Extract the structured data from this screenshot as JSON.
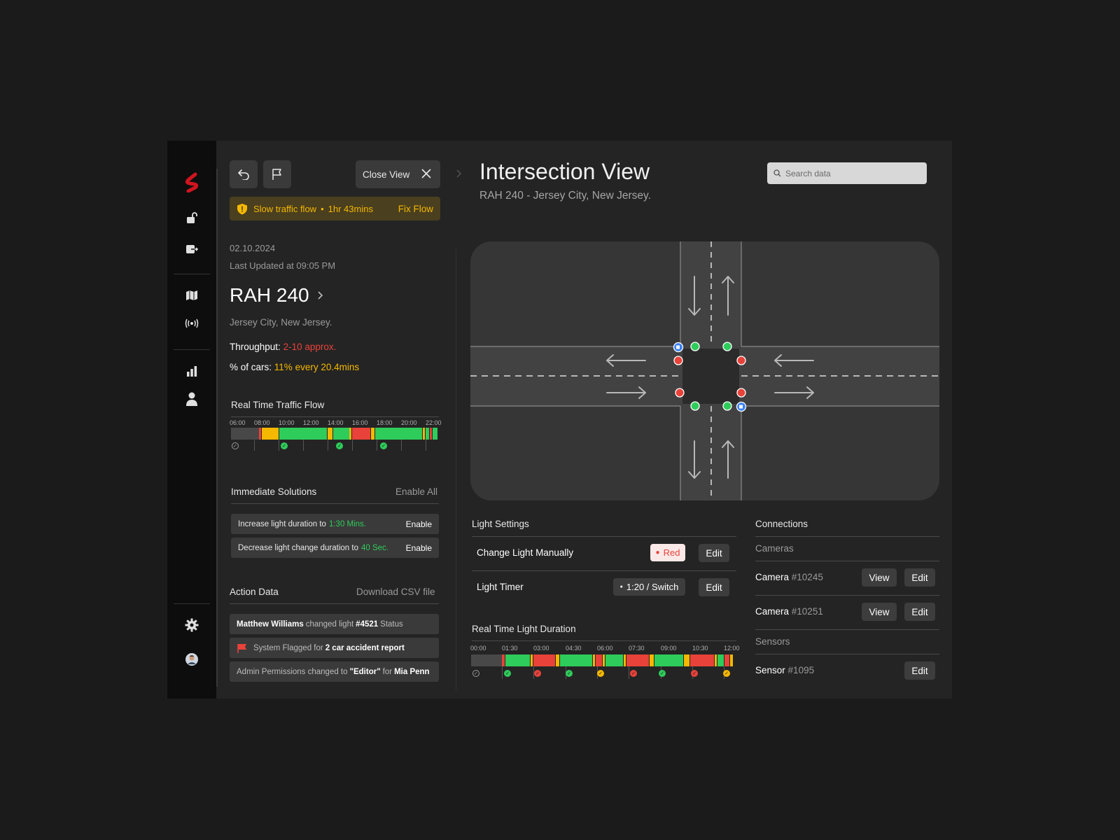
{
  "rail": {
    "icons": [
      "logo-icon",
      "unlock-icon",
      "logout-icon",
      "map-icon",
      "broadcast-icon",
      "bar-chart-icon",
      "user-icon",
      "gear-icon",
      "avatar"
    ]
  },
  "header": {
    "close_view": "Close View",
    "alert_text": "Slow traffic flow",
    "alert_duration": "1hr 43mins",
    "fix_flow": "Fix Flow"
  },
  "info": {
    "date": "02.10.2024",
    "last_updated": "Last Updated at 09:05 PM",
    "title": "RAH 240",
    "location": "Jersey City, New Jersey.",
    "throughput_label": "Throughput:",
    "throughput_value": "2-10 approx.",
    "cars_label": "% of cars:",
    "cars_value": "11% every 20.4mins"
  },
  "traffic_flow": {
    "title": "Real Time Traffic Flow",
    "times": [
      "06:00",
      "08:00",
      "10:00",
      "12:00",
      "14:00",
      "16:00",
      "18:00",
      "20:00",
      "22:00"
    ]
  },
  "solutions": {
    "title": "Immediate Solutions",
    "enable_all": "Enable All",
    "items": [
      {
        "text": "Increase light duration to",
        "value": "1:30 Mins.",
        "action": "Enable"
      },
      {
        "text": "Decrease light change duration to",
        "value": "40 Sec.",
        "action": "Enable"
      }
    ]
  },
  "action_data": {
    "title": "Action Data",
    "download": "Download CSV file",
    "rows": [
      {
        "a": "Matthew Williams",
        "b": "changed light",
        "c": "#4521",
        "d": "Status"
      },
      {
        "a": "System Flagged for",
        "b": "2 car accident report"
      },
      {
        "a": "Admin Permissions changed to",
        "b": "\"Editor\"",
        "c": "for",
        "d": "Mia Penn"
      }
    ]
  },
  "main": {
    "title": "Intersection View",
    "subtitle": "RAH 240 - Jersey City, New Jersey.",
    "search_placeholder": "Search data"
  },
  "light_settings": {
    "title": "Light Settings",
    "manual_label": "Change Light Manually",
    "manual_value": "Red",
    "timer_label": "Light Timer",
    "timer_value": "1:20 / Switch",
    "edit": "Edit"
  },
  "light_duration": {
    "title": "Real Time Light Duration",
    "times": [
      "00:00",
      "01:30",
      "03:00",
      "04:30",
      "06:00",
      "07:30",
      "09:00",
      "10:30",
      "12:00"
    ]
  },
  "connections": {
    "title": "Connections",
    "cameras_label": "Cameras",
    "sensors_label": "Sensors",
    "camera_word": "Camera",
    "sensor_word": "Sensor",
    "cameras": [
      {
        "id": "#10245",
        "view": "View",
        "edit": "Edit"
      },
      {
        "id": "#10251",
        "view": "View",
        "edit": "Edit"
      }
    ],
    "sensor_id": "#1095",
    "sensor_edit": "Edit"
  },
  "colors": {
    "green": "#2ecc5a",
    "yellow": "#f5b800",
    "red": "#e8423a",
    "blue": "#3b82f6",
    "brand": "#d0151f"
  }
}
